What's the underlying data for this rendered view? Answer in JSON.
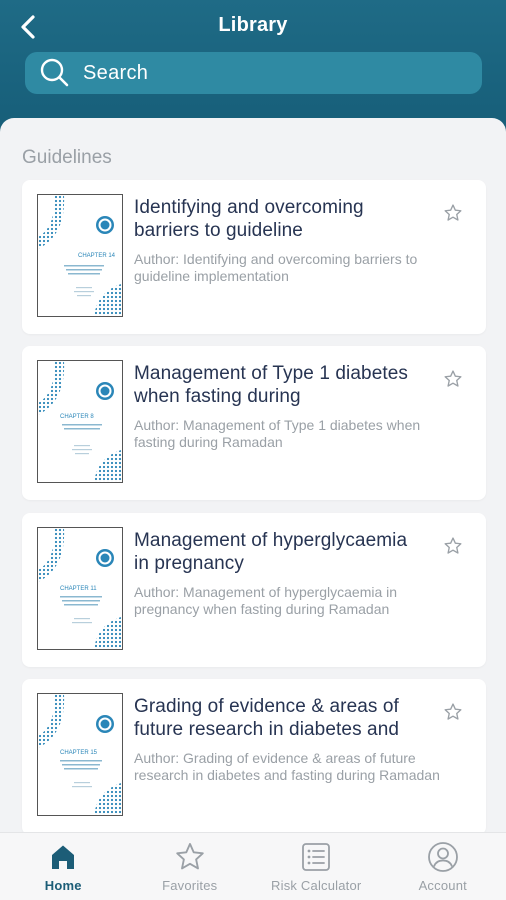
{
  "header": {
    "title": "Library",
    "search_placeholder": "Search"
  },
  "section": {
    "title": "Guidelines"
  },
  "guidelines": [
    {
      "title": "Identifying and overcoming barriers to guideline",
      "author": "Author: Identifying and overcoming barriers to guideline implementation",
      "cover_chapter": "CHAPTER 14"
    },
    {
      "title": "Management of Type 1 diabetes when fasting during",
      "author": "Author: Management of Type 1 diabetes when fasting during Ramadan",
      "cover_chapter": "CHAPTER 8"
    },
    {
      "title": "Management of hyperglycaemia in pregnancy",
      "author": "Author: Management of hyperglycaemia in pregnancy when fasting during Ramadan",
      "cover_chapter": "CHAPTER 11"
    },
    {
      "title": "Grading of evidence & areas of future research in diabetes and",
      "author": "Author: Grading of evidence & areas of future research in diabetes and fasting during Ramadan",
      "cover_chapter": "CHAPTER 15"
    }
  ],
  "tabbar": {
    "items": [
      {
        "label": "Home",
        "icon": "home-icon",
        "active": true
      },
      {
        "label": "Favorites",
        "icon": "star-icon",
        "active": false
      },
      {
        "label": "Risk Calculator",
        "icon": "list-icon",
        "active": false
      },
      {
        "label": "Account",
        "icon": "user-icon",
        "active": false
      }
    ]
  },
  "colors": {
    "header_bg": "#19627d",
    "search_bg": "#2f8aa3",
    "title_text": "#273452",
    "muted_text": "#9aa0a6",
    "active_tab": "#1c5d77",
    "cover_accent": "#2a86b8"
  }
}
